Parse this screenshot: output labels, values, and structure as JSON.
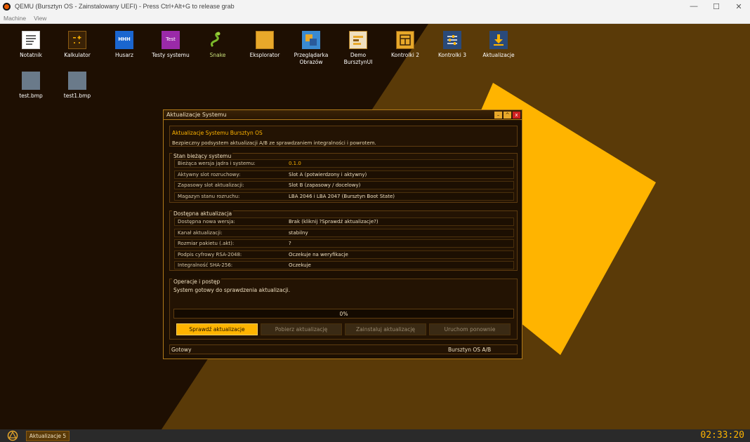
{
  "host": {
    "title": "QEMU (Bursztyn OS - Zainstalowany UEFI) - Press Ctrl+Alt+G to release grab",
    "menu": [
      "Machine",
      "View"
    ],
    "controls": [
      "—",
      "☐",
      "✕"
    ]
  },
  "desktop": {
    "icons": [
      {
        "label": "Notatnik",
        "icon": "notepad-icon"
      },
      {
        "label": "Kalkulator",
        "icon": "calculator-icon"
      },
      {
        "label": "Husarz",
        "icon": "husarz-icon",
        "glyph": "HHH"
      },
      {
        "label": "Testy systemu",
        "icon": "test-icon",
        "glyph": "Test"
      },
      {
        "label": "Snake",
        "icon": "snake-icon"
      },
      {
        "label": "Eksplorator",
        "icon": "folder-icon"
      },
      {
        "label": "Przeglądarka Obrazów",
        "icon": "image-viewer-icon"
      },
      {
        "label": "Demo BursztynUI",
        "icon": "demo-icon"
      },
      {
        "label": "Kontrolki 2",
        "icon": "controls-icon"
      },
      {
        "label": "Kontrolki 3",
        "icon": "sliders-icon"
      },
      {
        "label": "Aktualizacje",
        "icon": "download-icon"
      },
      {
        "label": "test.bmp",
        "icon": "bmp-file-icon"
      },
      {
        "label": "test1.bmp",
        "icon": "bmp-file-icon"
      }
    ]
  },
  "window": {
    "title": "Aktualizacje Systemu",
    "controls": [
      "–",
      "^",
      "x"
    ],
    "header": {
      "title": "Aktualizacje Systemu Bursztyn OS",
      "subtitle": "Bezpieczny podsystem aktualizacji A/B ze sprawdzaniem integralności i powrotem."
    },
    "current": {
      "title": "Stan bieżący systemu",
      "rows": [
        {
          "k": "Bieżąca wersja jądra i systemu:",
          "v": "0.1.0"
        },
        {
          "k": "Aktywny slot rozruchowy:",
          "v": "Slot A (potwierdzony i aktywny)"
        },
        {
          "k": "Zapasowy slot aktualizacji:",
          "v": "Slot B (zapasowy / docelowy)"
        },
        {
          "k": "Magazyn stanu rozruchu:",
          "v": "LBA 2046 i LBA 2047 (Bursztyn Boot State)"
        }
      ]
    },
    "available": {
      "title": "Dostępna aktualizacja",
      "rows": [
        {
          "k": "Dostępna nowa wersja:",
          "v": "Brak (kliknij ?Sprawdź aktualizacje?)"
        },
        {
          "k": "Kanał aktualizacji:",
          "v": "stabilny"
        },
        {
          "k": "Rozmiar pakietu (.akt):",
          "v": "?"
        },
        {
          "k": "Podpis cyfrowy RSA-2048:",
          "v": "Oczekuje na weryfikacje"
        },
        {
          "k": "Integralność SHA-256:",
          "v": "Oczekuje"
        }
      ]
    },
    "operations": {
      "title": "Operacje i postęp",
      "message": "System gotowy do sprawdzenia aktualizacji.",
      "progress_label": "0%",
      "progress": 0
    },
    "buttons": {
      "check": "Sprawdź aktualizacje",
      "download": "Pobierz aktualizację",
      "install": "Zainstaluj aktualizację",
      "restart": "Uruchom ponownie"
    },
    "status": {
      "left": "Gotowy",
      "right": "Bursztyn OS A/B"
    }
  },
  "taskbar": {
    "task": "Aktualizacje 5",
    "clock": "02:33:20"
  },
  "colors": {
    "accent": "#ffb400",
    "desktop_dark": "#1e0f02",
    "desktop_brown": "#5a3a08"
  }
}
